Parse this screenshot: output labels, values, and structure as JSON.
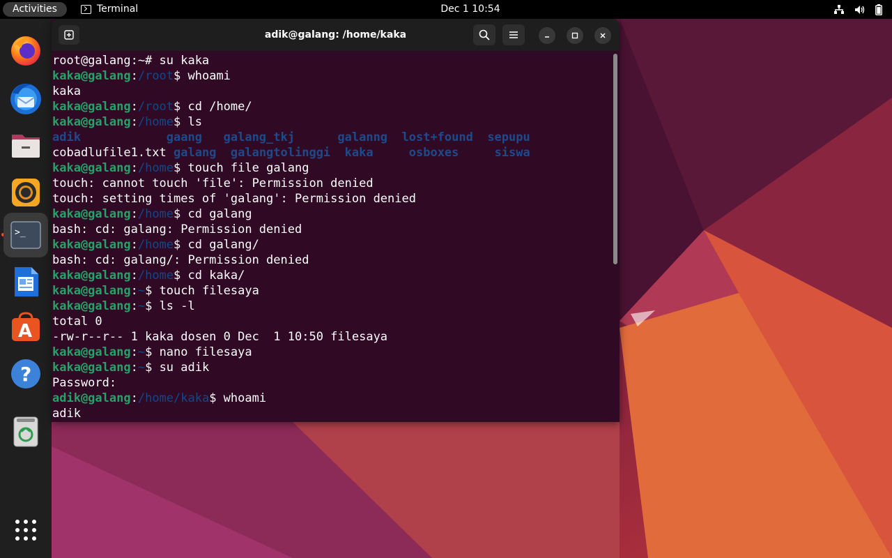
{
  "topbar": {
    "activities_label": "Activities",
    "app_name": "Terminal",
    "clock": "Dec 1  10:54",
    "icons": [
      "network-icon",
      "volume-icon",
      "battery-icon"
    ]
  },
  "dock": {
    "items": [
      {
        "name": "firefox",
        "icon": "firefox-icon"
      },
      {
        "name": "thunderbird",
        "icon": "thunderbird-icon"
      },
      {
        "name": "files",
        "icon": "files-icon"
      },
      {
        "name": "rhythmbox",
        "icon": "rhythmbox-icon"
      },
      {
        "name": "terminal",
        "icon": "terminal-icon",
        "active": true
      },
      {
        "name": "writer",
        "icon": "writer-icon"
      },
      {
        "name": "app-center",
        "icon": "app-center-icon"
      },
      {
        "name": "help",
        "icon": "help-icon"
      },
      {
        "name": "trash",
        "icon": "trash-icon"
      },
      {
        "name": "show-apps",
        "icon": "grid-icon"
      }
    ]
  },
  "window": {
    "title": "adik@galang: /home/kaka",
    "header_icons": [
      "new-tab-icon",
      "search-icon",
      "menu-icon",
      "minimize-icon",
      "maximize-icon",
      "close-icon"
    ]
  },
  "terminal": {
    "lines": [
      [
        [
          "w",
          "root@galang:~# su kaka"
        ]
      ],
      [
        [
          "g",
          "kaka@galang"
        ],
        [
          "w",
          ":"
        ],
        [
          "b",
          "/root"
        ],
        [
          "w",
          "$ whoami"
        ]
      ],
      [
        [
          "w",
          "kaka"
        ]
      ],
      [
        [
          "g",
          "kaka@galang"
        ],
        [
          "w",
          ":"
        ],
        [
          "b",
          "/root"
        ],
        [
          "w",
          "$ cd /home/"
        ]
      ],
      [
        [
          "g",
          "kaka@galang"
        ],
        [
          "w",
          ":"
        ],
        [
          "b",
          "/home"
        ],
        [
          "w",
          "$ ls"
        ]
      ],
      [
        [
          "db",
          "adik            gaang   galang_tkj      galanng  lost+found  sepupu"
        ]
      ],
      [
        [
          "w",
          "cobadlufile1.txt "
        ],
        [
          "db",
          "galang  galangtolinggi  kaka     osboxes     siswa"
        ]
      ],
      [
        [
          "g",
          "kaka@galang"
        ],
        [
          "w",
          ":"
        ],
        [
          "b",
          "/home"
        ],
        [
          "w",
          "$ touch file galang"
        ]
      ],
      [
        [
          "w",
          "touch: cannot touch 'file': Permission denied"
        ]
      ],
      [
        [
          "w",
          "touch: setting times of 'galang': Permission denied"
        ]
      ],
      [
        [
          "g",
          "kaka@galang"
        ],
        [
          "w",
          ":"
        ],
        [
          "b",
          "/home"
        ],
        [
          "w",
          "$ cd galang"
        ]
      ],
      [
        [
          "w",
          "bash: cd: galang: Permission denied"
        ]
      ],
      [
        [
          "g",
          "kaka@galang"
        ],
        [
          "w",
          ":"
        ],
        [
          "b",
          "/home"
        ],
        [
          "w",
          "$ cd galang/"
        ]
      ],
      [
        [
          "w",
          "bash: cd: galang/: Permission denied"
        ]
      ],
      [
        [
          "g",
          "kaka@galang"
        ],
        [
          "w",
          ":"
        ],
        [
          "b",
          "/home"
        ],
        [
          "w",
          "$ cd kaka/"
        ]
      ],
      [
        [
          "g",
          "kaka@galang"
        ],
        [
          "w",
          ":"
        ],
        [
          "b",
          "~"
        ],
        [
          "w",
          "$ touch filesaya"
        ]
      ],
      [
        [
          "g",
          "kaka@galang"
        ],
        [
          "w",
          ":"
        ],
        [
          "b",
          "~"
        ],
        [
          "w",
          "$ ls -l"
        ]
      ],
      [
        [
          "w",
          "total 0"
        ]
      ],
      [
        [
          "w",
          "-rw-r--r-- 1 kaka dosen 0 Dec  1 10:50 filesaya"
        ]
      ],
      [
        [
          "g",
          "kaka@galang"
        ],
        [
          "w",
          ":"
        ],
        [
          "b",
          "~"
        ],
        [
          "w",
          "$ nano filesaya"
        ]
      ],
      [
        [
          "g",
          "kaka@galang"
        ],
        [
          "w",
          ":"
        ],
        [
          "b",
          "~"
        ],
        [
          "w",
          "$ su adik"
        ]
      ],
      [
        [
          "w",
          "Password:"
        ]
      ],
      [
        [
          "g",
          "adik@galang"
        ],
        [
          "w",
          ":"
        ],
        [
          "b",
          "/home/kaka"
        ],
        [
          "w",
          "$ whoami"
        ]
      ],
      [
        [
          "w",
          "adik"
        ]
      ]
    ]
  },
  "colors": {
    "terminal_bg": "#300a24",
    "prompt_user": "#26a269",
    "prompt_path": "#12488b",
    "accent": "#e95420"
  }
}
